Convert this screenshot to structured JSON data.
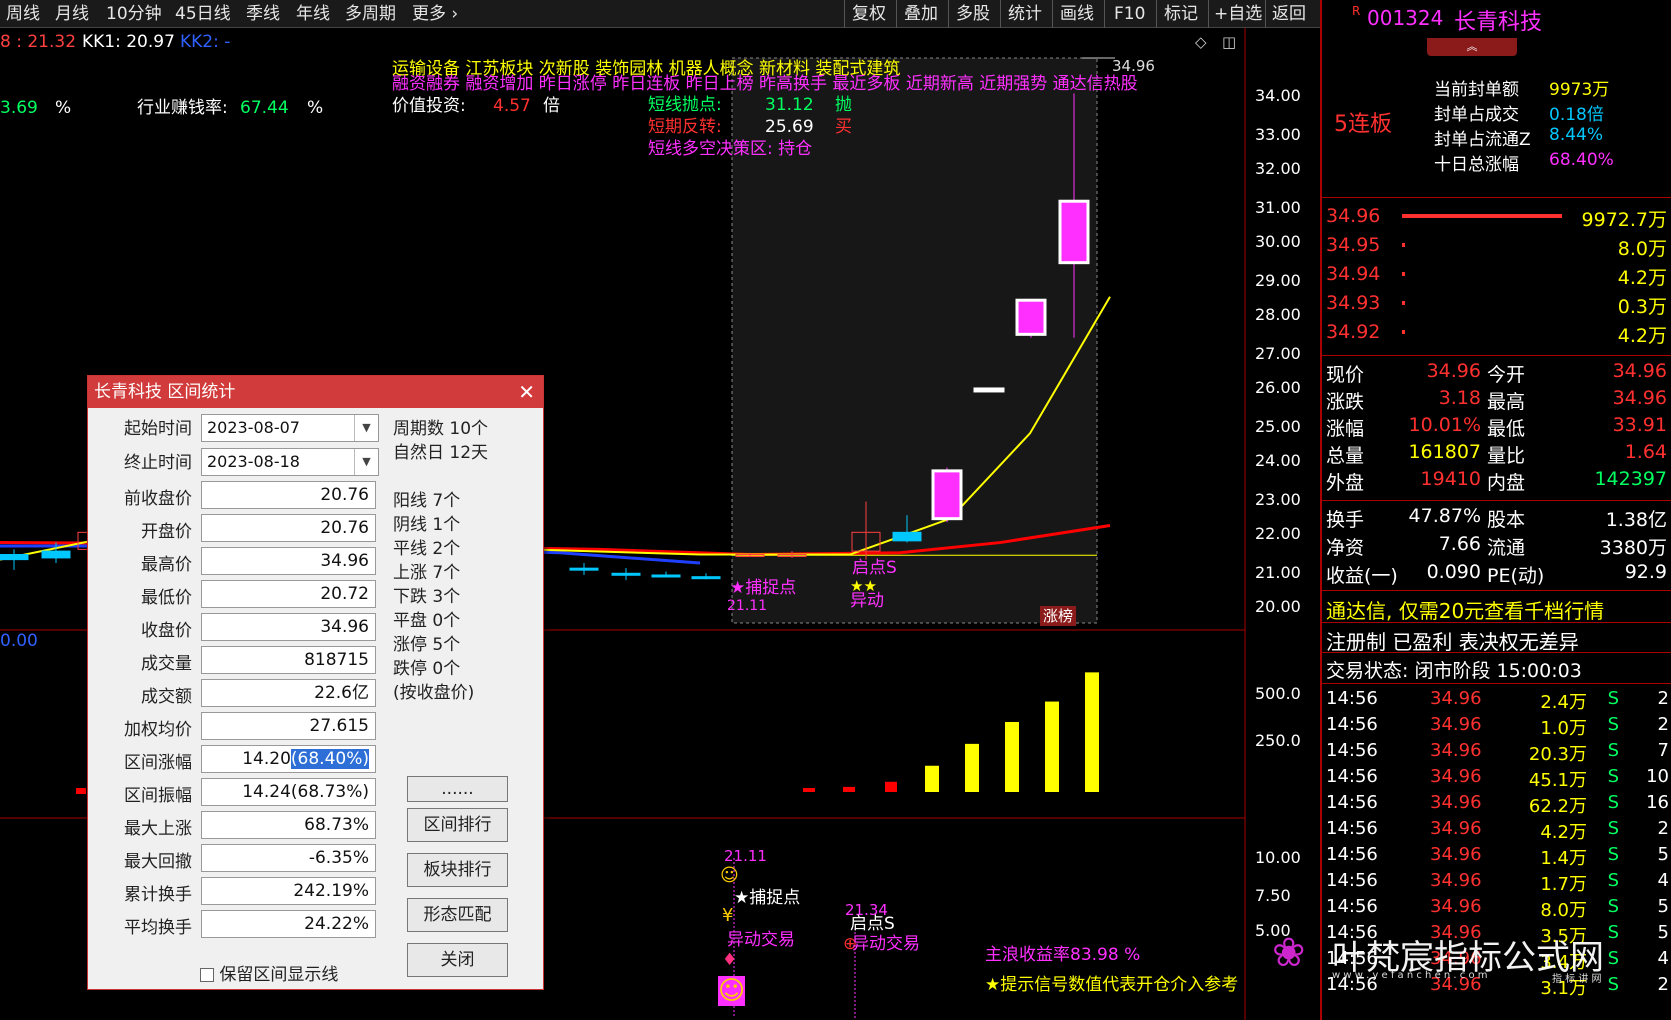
{
  "toolbar": {
    "items": [
      "周线",
      "月线",
      "10分钟",
      "45日线",
      "季线",
      "年线",
      "多周期",
      "更多",
      "复权",
      "叠加",
      "多股",
      "统计",
      "画线",
      "F10",
      "标记",
      "+自选",
      "返回"
    ]
  },
  "legend": {
    "ma_line": "8 : 21.32",
    "kk1": "KK1: 20.97",
    "kk2": "KK2: -",
    "left_val": "3.69",
    "pct1": "%",
    "industry_label": "行业赚钱率:",
    "industry_val": "67.44",
    "pct2": "%",
    "value_label": "价值投资:",
    "value_val": "4.57",
    "value_unit": "倍"
  },
  "tags": {
    "line1": "运输设备  江苏板块  次新股 装饰园林 机器人概念 新材料 装配式建筑",
    "line2": "融资融券 融资增加 昨日涨停 昨日连板 昨日上榜 昨高换手 最近多板 近期新高 近期强势 通达信热股"
  },
  "signals": {
    "sell_label": "短线抛点:",
    "sell_val": "31.12",
    "sell_mark": "抛",
    "rev_label": "短期反转:",
    "rev_val": "25.69",
    "rev_mark": "买",
    "zone": "短线多空决策区: 持仓",
    "peak_label": "34.96",
    "catch_label": "★捕捉点",
    "catch_price": "21.11",
    "start_label": "启点S",
    "abn_label": "异动",
    "zt_tag": "涨榜",
    "blue_val": "0.00"
  },
  "lower": {
    "ind_price1": "21.11",
    "ind_catch": "★捕捉点",
    "ind_abn1": "异动交易",
    "ind_price2": "21.34",
    "ind_start": "启点S",
    "ind_abn2": "异动交易",
    "main_wave": "主浪收益率83.98 %",
    "hint": "★提示信号数值代表开仓介入参考"
  },
  "axis": {
    "price": [
      "34.00",
      "33.00",
      "32.00",
      "31.00",
      "30.00",
      "29.00",
      "28.00",
      "27.00",
      "26.00",
      "25.00",
      "24.00",
      "23.00",
      "22.00",
      "21.00",
      "20.00"
    ],
    "vol": [
      "500.0",
      "250.0"
    ],
    "ind": [
      "10.00",
      "7.50",
      "5.00"
    ]
  },
  "chart_data": {
    "type": "candlestick",
    "candles": [
      {
        "o": 21.3,
        "h": 21.6,
        "l": 21.0,
        "c": 21.45,
        "color": "#00c8ff"
      },
      {
        "o": 21.55,
        "h": 21.8,
        "l": 21.2,
        "c": 21.35,
        "color": "#00c8ff"
      },
      {
        "o": 21.6,
        "h": 22.4,
        "l": 21.3,
        "c": 22.1,
        "color": "#ff4040"
      },
      {
        "o": 21.05,
        "h": 21.2,
        "l": 20.85,
        "c": 21.0,
        "color": "#00c8ff"
      },
      {
        "o": 20.9,
        "h": 21.05,
        "l": 20.7,
        "c": 20.85,
        "color": "#00c8ff"
      },
      {
        "o": 20.85,
        "h": 20.95,
        "l": 20.8,
        "c": 20.85,
        "color": "#00c8ff"
      },
      {
        "o": 20.8,
        "h": 20.9,
        "l": 20.72,
        "c": 20.8,
        "color": "#00c8ff"
      },
      {
        "o": 21.4,
        "h": 21.5,
        "l": 21.4,
        "c": 21.45,
        "color": "#ff4040"
      },
      {
        "o": 21.45,
        "h": 21.55,
        "l": 21.35,
        "c": 21.45,
        "color": "#ff4040"
      },
      {
        "o": 21.55,
        "h": 23.0,
        "l": 21.3,
        "c": 22.1,
        "color": "#ff4040"
      },
      {
        "o": 22.1,
        "h": 22.6,
        "l": 21.8,
        "c": 21.85,
        "color": "#00c8ff"
      },
      {
        "o": 22.5,
        "h": 24.0,
        "l": 22.4,
        "c": 23.9,
        "color": "#ff30ff"
      },
      {
        "o": 26.3,
        "h": 26.3,
        "l": 26.3,
        "c": 26.3,
        "color": "#ff30ff"
      },
      {
        "o": 27.9,
        "h": 28.9,
        "l": 27.8,
        "c": 28.9,
        "color": "#ff30ff"
      },
      {
        "o": 30.0,
        "h": 34.96,
        "l": 27.8,
        "c": 31.8,
        "color": "#ff30ff"
      }
    ],
    "volume": [
      4,
      20,
      35,
      70,
      180,
      330,
      480,
      620,
      820
    ],
    "ylim": [
      20,
      35
    ],
    "vol_lim": [
      0,
      850
    ]
  },
  "dialog": {
    "title": "长青科技 区间统计",
    "start_label": "起始时间",
    "start_val": "2023-08-07",
    "end_label": "终止时间",
    "end_val": "2023-08-18",
    "rows": [
      {
        "label": "前收盘价",
        "value": "20.76"
      },
      {
        "label": "开盘价",
        "value": "20.76"
      },
      {
        "label": "最高价",
        "value": "34.96"
      },
      {
        "label": "最低价",
        "value": "20.72"
      },
      {
        "label": "收盘价",
        "value": "34.96"
      },
      {
        "label": "成交量",
        "value": "818715"
      },
      {
        "label": "成交额",
        "value": "22.6亿"
      },
      {
        "label": "加权均价",
        "value": "27.615"
      },
      {
        "label": "区间涨幅",
        "value": "14.20",
        "value2": "(68.40%)"
      },
      {
        "label": "区间振幅",
        "value": "14.24(68.73%)"
      },
      {
        "label": "最大上涨",
        "value": "68.73%"
      },
      {
        "label": "最大回撤",
        "value": "-6.35%"
      },
      {
        "label": "累计换手",
        "value": "242.19%"
      },
      {
        "label": "平均换手",
        "value": "24.22%"
      }
    ],
    "info": [
      "周期数 10个",
      "自然日 12天",
      "阳线 7个",
      "阴线 1个",
      "平线 2个",
      "上涨 7个",
      "下跌 3个",
      "平盘 0个",
      "涨停 5个",
      "跌停 0个",
      "(按收盘价)"
    ],
    "buttons": [
      "......",
      "区间排行",
      "板块排行",
      "形态匹配",
      "关闭"
    ],
    "checkbox": "保留区间显示线"
  },
  "panel": {
    "code_mark": "R",
    "code": "001324",
    "name": "长青科技",
    "board": "5连板",
    "seal_amt_label": "当前封单额",
    "seal_amt": "9973万",
    "seal_deal_label": "封单占成交",
    "seal_deal": "0.18倍",
    "seal_float_label": "封单占流通Z",
    "seal_float": "8.44%",
    "ten_day_label": "十日总涨幅",
    "ten_day": "68.40%",
    "bids": [
      {
        "price": "34.96",
        "vol": "9972.7万"
      },
      {
        "price": "34.95",
        "vol": "8.0万"
      },
      {
        "price": "34.94",
        "vol": "4.2万"
      },
      {
        "price": "34.93",
        "vol": "0.3万"
      },
      {
        "price": "34.92",
        "vol": "4.2万"
      }
    ],
    "quote": [
      {
        "l1": "现价",
        "v1": "34.96",
        "l2": "今开",
        "v2": "34.96"
      },
      {
        "l1": "涨跌",
        "v1": "3.18",
        "l2": "最高",
        "v2": "34.96"
      },
      {
        "l1": "涨幅",
        "v1": "10.01%",
        "l2": "最低",
        "v2": "33.91"
      },
      {
        "l1": "总量",
        "v1": "161807",
        "l2": "量比",
        "v2": "1.64"
      },
      {
        "l1": "外盘",
        "v1": "19410",
        "l2": "内盘",
        "v2": "142397"
      }
    ],
    "fund": [
      {
        "l1": "换手",
        "v1": "47.87%",
        "l2": "股本",
        "v2": "1.38亿"
      },
      {
        "l1": "净资",
        "v1": "7.66",
        "l2": "流通",
        "v2": "3380万"
      },
      {
        "l1": "收益(一)",
        "v1": "0.090",
        "l2": "PE(动)",
        "v2": "92.9"
      }
    ],
    "promo": "通达信, 仅需20元查看千档行情",
    "reg": "注册制 已盈利 表决权无差异",
    "status": "交易状态: 闭市阶段 15:00:03",
    "ticks": [
      {
        "t": "14:56",
        "p": "34.96",
        "v": "2.4万",
        "s": "S",
        "n": "2"
      },
      {
        "t": "14:56",
        "p": "34.96",
        "v": "1.0万",
        "s": "S",
        "n": "2"
      },
      {
        "t": "14:56",
        "p": "34.96",
        "v": "20.3万",
        "s": "S",
        "n": "7"
      },
      {
        "t": "14:56",
        "p": "34.96",
        "v": "45.1万",
        "s": "S",
        "n": "10"
      },
      {
        "t": "14:56",
        "p": "34.96",
        "v": "62.2万",
        "s": "S",
        "n": "16"
      },
      {
        "t": "14:56",
        "p": "34.96",
        "v": "4.2万",
        "s": "S",
        "n": "2"
      },
      {
        "t": "14:56",
        "p": "34.96",
        "v": "1.4万",
        "s": "S",
        "n": "5"
      },
      {
        "t": "14:56",
        "p": "34.96",
        "v": "1.7万",
        "s": "S",
        "n": "4"
      },
      {
        "t": "14:56",
        "p": "34.96",
        "v": "8.0万",
        "s": "S",
        "n": "5"
      },
      {
        "t": "14:56",
        "p": "34.96",
        "v": "3.5万",
        "s": "S",
        "n": "5"
      },
      {
        "t": "14:56",
        "p": "34.96",
        "v": "3.4万",
        "s": "S",
        "n": "4"
      },
      {
        "t": "14:56",
        "p": "34.96",
        "v": "3.1万",
        "s": "S",
        "n": "2"
      }
    ]
  },
  "watermark": {
    "title": "叶梵宸指标公式网",
    "url": "w w w . y e f a n c h e n . c o m",
    "sub": "指 标 讲 网"
  },
  "colors": {
    "up": "#ff3030",
    "magenta": "#ff30ff",
    "cyan": "#00c8ff",
    "yellow": "#ffff00",
    "green": "#00ff60"
  }
}
